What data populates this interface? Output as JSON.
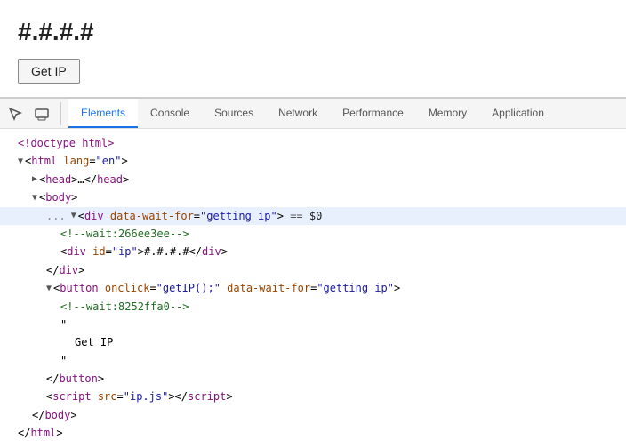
{
  "page": {
    "ip_display": "#.#.#.#",
    "get_ip_button": "Get IP"
  },
  "devtools": {
    "toolbar": {
      "inspect_icon": "⊹",
      "device_icon": "▭"
    },
    "tabs": [
      {
        "id": "elements",
        "label": "Elements",
        "active": true
      },
      {
        "id": "console",
        "label": "Console",
        "active": false
      },
      {
        "id": "sources",
        "label": "Sources",
        "active": false
      },
      {
        "id": "network",
        "label": "Network",
        "active": false
      },
      {
        "id": "performance",
        "label": "Performance",
        "active": false
      },
      {
        "id": "memory",
        "label": "Memory",
        "active": false
      },
      {
        "id": "application",
        "label": "Application",
        "active": false
      }
    ],
    "html_lines": [
      {
        "id": "doctype",
        "indent": 0,
        "text": "&lt;!doctype html&gt;",
        "type": "tag-line"
      },
      {
        "id": "html-open",
        "indent": 0,
        "triangle": "down",
        "text": "&lt;<span class='tag'>html</span> <span class='attr-name'>lang</span>=<span class='attr-value'>\"en\"</span>&gt;",
        "type": "tag-line"
      },
      {
        "id": "head",
        "indent": 1,
        "triangle": "right",
        "text": "&lt;<span class='tag'>head</span>&gt;…&lt;/<span class='tag'>head</span>&gt;",
        "type": "tag-line"
      },
      {
        "id": "body-open",
        "indent": 1,
        "triangle": "down",
        "text": "&lt;<span class='tag'>body</span>&gt;",
        "type": "tag-line"
      },
      {
        "id": "div-wait",
        "indent": 2,
        "triangle": "down",
        "highlighted": true,
        "dots": "...",
        "text": "&lt;<span class='tag'>div</span> <span class='attr-name'>data-wait-for</span>=<span class='attr-value'>\"getting ip\"</span>&gt; <span class='equals'>==</span> <span class='dollar-ref'>$0</span>",
        "type": "tag-line"
      },
      {
        "id": "comment1",
        "indent": 3,
        "text": "&lt;!--wait:266ee3ee--&gt;",
        "type": "comment-line"
      },
      {
        "id": "div-ip",
        "indent": 3,
        "text": "&lt;<span class='tag'>div</span> <span class='attr-name'>id</span>=<span class='attr-value'>\"ip\"</span>&gt;#.#.#.#&lt;/<span class='tag'>div</span>&gt;",
        "type": "tag-line"
      },
      {
        "id": "div-close",
        "indent": 2,
        "text": "&lt;/<span class='tag'>div</span>&gt;",
        "type": "tag-line"
      },
      {
        "id": "button-open",
        "indent": 2,
        "triangle": "down",
        "text": "&lt;<span class='tag'>button</span> <span class='attr-name'>onclick</span>=<span class='attr-value'>\"getIP();\"</span> <span class='attr-name'>data-wait-for</span>=<span class='attr-value'>\"getting ip\"</span>&gt;",
        "type": "tag-line"
      },
      {
        "id": "comment2",
        "indent": 3,
        "text": "&lt;!--wait:8252ffa0--&gt;",
        "type": "comment-line"
      },
      {
        "id": "quote1",
        "indent": 3,
        "text": "\"",
        "type": "text-line"
      },
      {
        "id": "get-ip-text",
        "indent": 4,
        "text": "Get IP",
        "type": "text-line"
      },
      {
        "id": "quote2",
        "indent": 3,
        "text": "\"",
        "type": "text-line"
      },
      {
        "id": "button-close",
        "indent": 2,
        "text": "&lt;/<span class='tag'>button</span>&gt;",
        "type": "tag-line"
      },
      {
        "id": "script-line",
        "indent": 2,
        "text": "&lt;<span class='tag'>script</span> <span class='attr-name'>src</span>=<span class='attr-value'>\"ip.js\"</span>&gt;&lt;/<span class='tag'>script</span>&gt;",
        "type": "tag-line"
      },
      {
        "id": "body-close",
        "indent": 1,
        "text": "&lt;/<span class='tag'>body</span>&gt;",
        "type": "tag-line"
      },
      {
        "id": "html-close",
        "indent": 0,
        "text": "&lt;/<span class='tag'>html</span>&gt;",
        "type": "tag-line"
      }
    ]
  }
}
